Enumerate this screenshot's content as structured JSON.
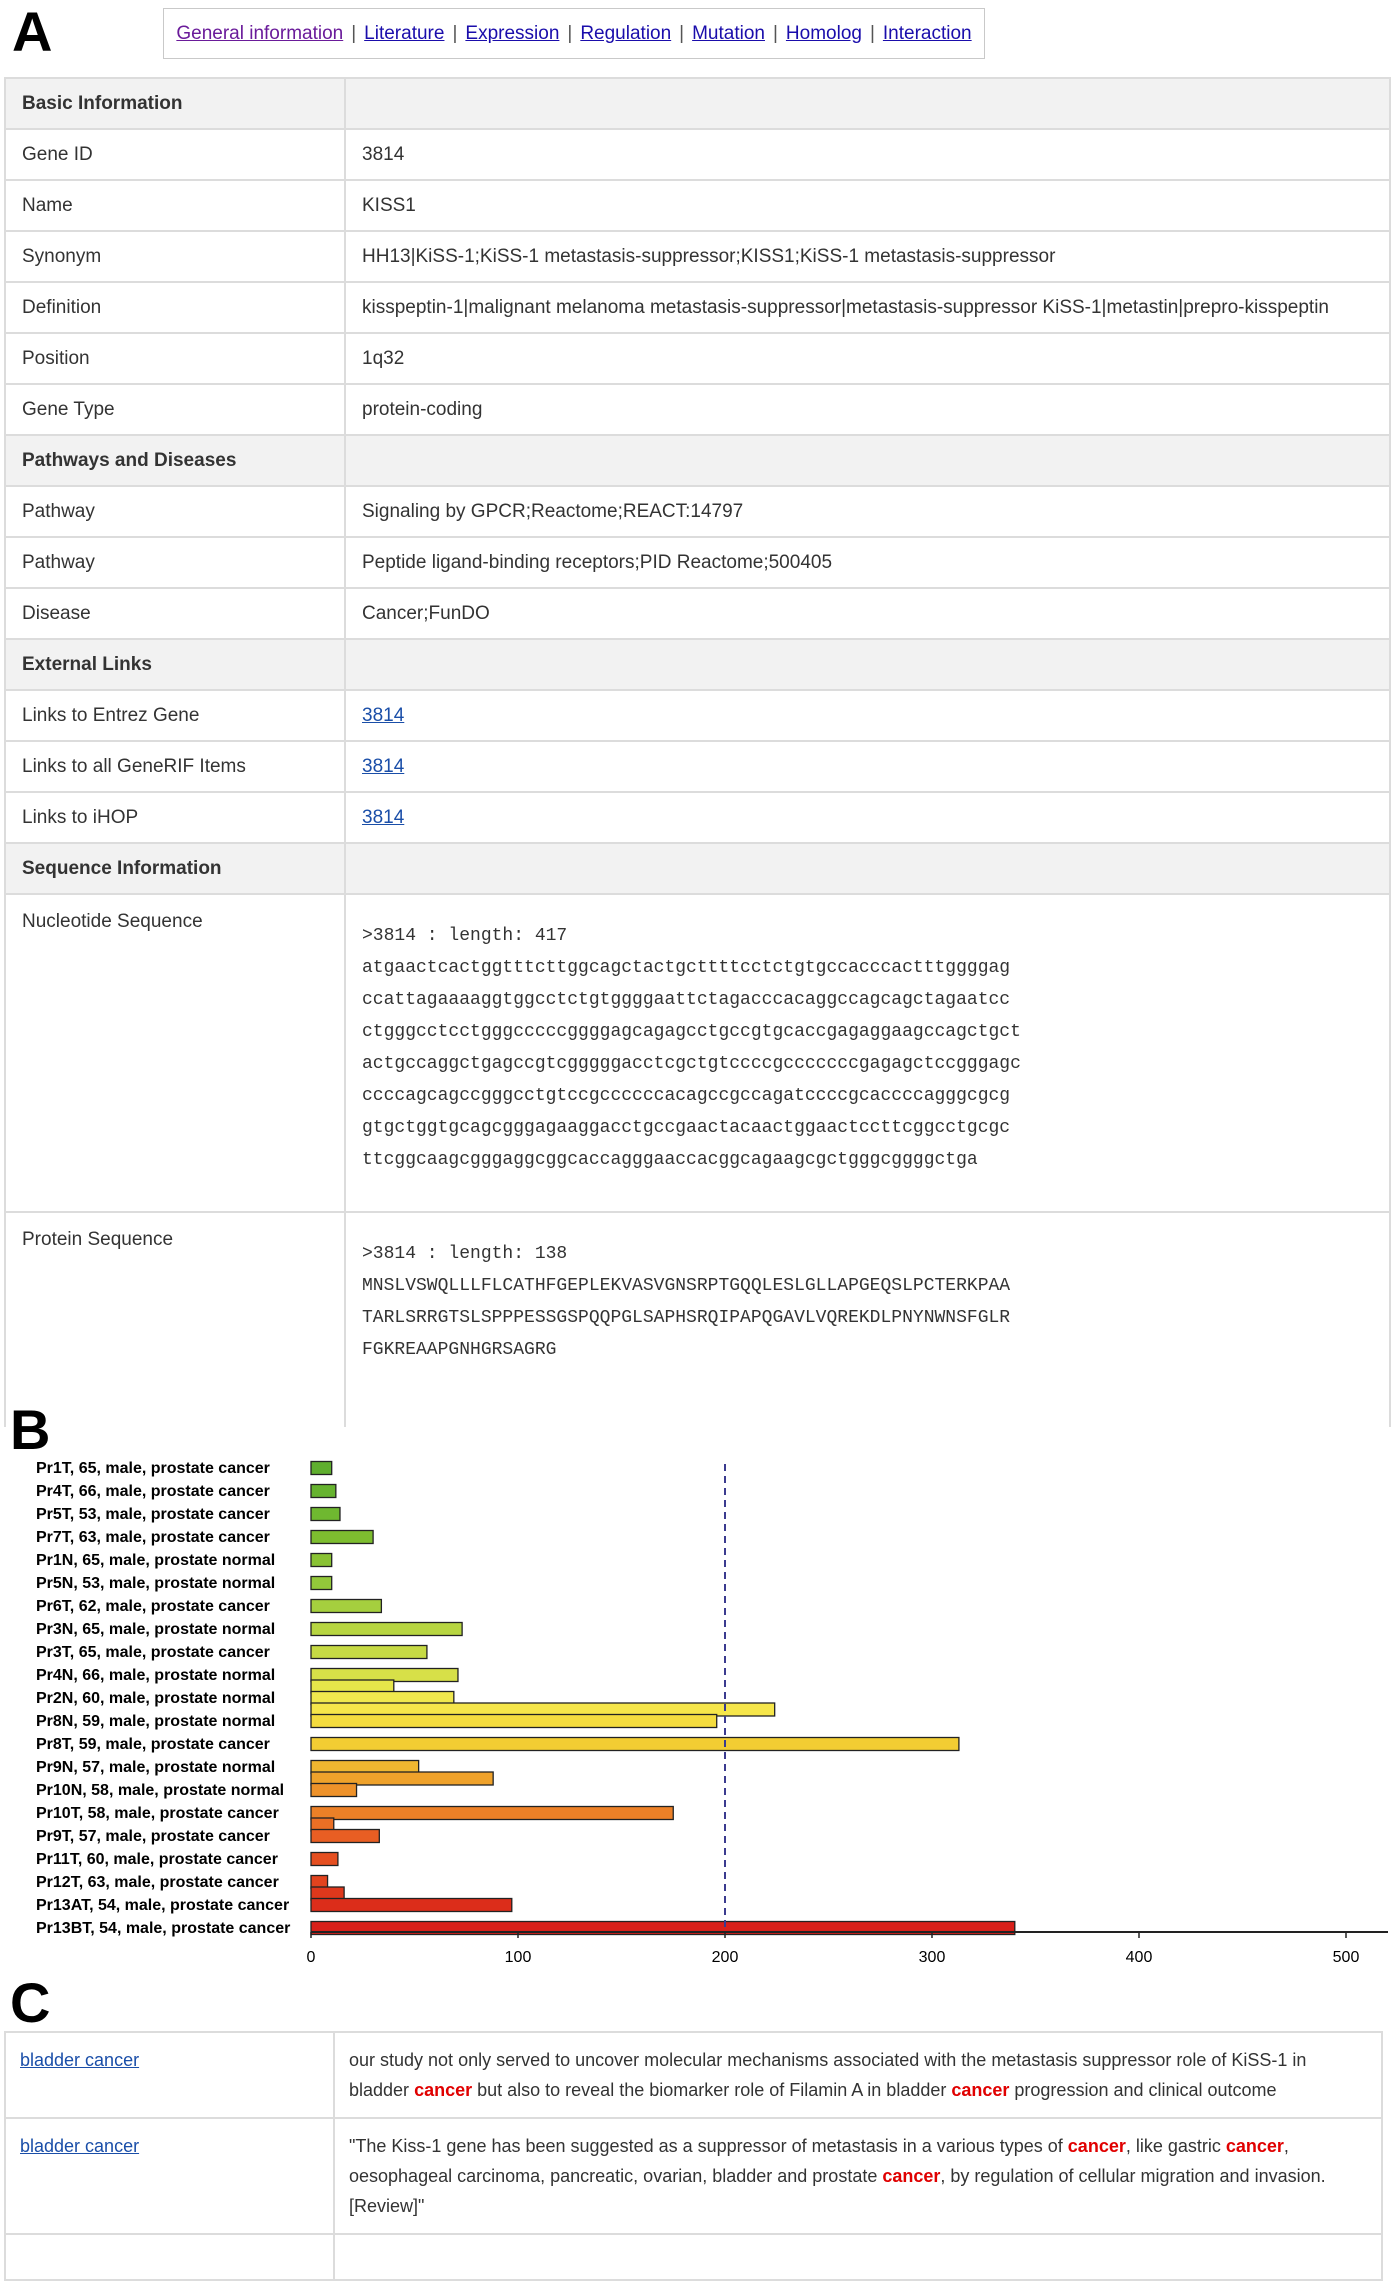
{
  "panels": {
    "a": "A",
    "b": "B",
    "c": "C"
  },
  "tabs": [
    {
      "label": "General information",
      "visited": true
    },
    {
      "label": "Literature"
    },
    {
      "label": "Expression"
    },
    {
      "label": "Regulation"
    },
    {
      "label": "Mutation"
    },
    {
      "label": "Homolog"
    },
    {
      "label": "Interaction"
    }
  ],
  "tab_separator": "|",
  "info": {
    "basic_header": "Basic Information",
    "gene_id": {
      "label": "Gene ID",
      "value": "3814"
    },
    "name": {
      "label": "Name",
      "value": "KISS1"
    },
    "synonym": {
      "label": "Synonym",
      "value": "HH13|KiSS-1;KiSS-1 metastasis-suppressor;KISS1;KiSS-1 metastasis-suppressor"
    },
    "definition": {
      "label": "Definition",
      "value": "kisspeptin-1|malignant melanoma metastasis-suppressor|metastasis-suppressor KiSS-1|metastin|prepro-kisspeptin"
    },
    "position": {
      "label": "Position",
      "value": "1q32"
    },
    "gene_type": {
      "label": "Gene Type",
      "value": "protein-coding"
    },
    "pathways_header": "Pathways and Diseases",
    "pathway1": {
      "label": "Pathway",
      "value": "Signaling by GPCR;Reactome;REACT:14797"
    },
    "pathway2": {
      "label": "Pathway",
      "value": "Peptide ligand-binding receptors;PID Reactome;500405"
    },
    "disease": {
      "label": "Disease",
      "value": "Cancer;FunDO"
    },
    "links_header": "External Links",
    "entrez": {
      "label": "Links to Entrez Gene",
      "value": "3814"
    },
    "generif": {
      "label": "Links to all GeneRIF Items",
      "value": "3814"
    },
    "ihop": {
      "label": "Links to iHOP",
      "value": "3814"
    },
    "sequence_header": "Sequence Information",
    "nucleotide": {
      "label": "Nucleotide Sequence",
      "lines": [
        ">3814 : length: 417",
        "atgaactcactggtttcttggcagctactgcttttcctctgtgccacccactttggggag",
        "ccattagaaaaggtggcctctgtggggaattctagacccacaggccagcagctagaatcc",
        "ctgggcctcctgggcccccggggagcagagcctgccgtgcaccgagaggaagccagctgct",
        "actgccaggctgagccgtcgggggacctcgctgtccccgcccccccgagagctccgggagc",
        "ccccagcagccgggcctgtccgccccccacagccgccagatccccgcaccccagggcgcg",
        "gtgctggtgcagcgggagaaggacctgccgaactacaactggaactccttcggcctgcgc",
        "ttcggcaagcgggaggcggcaccagggaaccacggcagaagcgctgggcggggctga"
      ]
    },
    "protein": {
      "label": "Protein Sequence",
      "lines": [
        ">3814 : length: 138",
        "MNSLVSWQLLLFLCATHFGEPLEKVASVGNSRPTGQQLESLGLLAPGEQSLPCTERKPAA",
        "TARLSRRGTSLSPPPESSGSPQQPGLSAPHSRQIPAPQGAVLVQREKDLPNYNWNSFGLR",
        "FGKREAAPGNHGRSAGRG"
      ]
    }
  },
  "chart_data": {
    "type": "bar",
    "orientation": "horizontal",
    "categories": [
      "Pr1T, 65, male, prostate cancer",
      "Pr4T, 66, male, prostate cancer",
      "Pr5T, 53, male, prostate cancer",
      "Pr7T, 63, male, prostate cancer",
      "Pr1N, 65, male, prostate normal",
      "Pr5N, 53, male, prostate normal",
      "Pr6T, 62, male, prostate cancer",
      "Pr3N, 65, male, prostate normal",
      "Pr3T, 65, male, prostate cancer",
      "Pr4N, 66, male, prostate normal",
      "Pr2N, 60, male, prostate normal",
      "Pr8N, 59, male, prostate normal",
      "Pr8T, 59, male, prostate cancer",
      "Pr9N, 57, male, prostate normal",
      "Pr10N, 58, male, prostate normal",
      "Pr10T, 58, male, prostate cancer",
      "Pr9T, 57, male, prostate cancer",
      "Pr11T, 60, male, prostate cancer",
      "Pr12T, 63, male, prostate cancer",
      "Pr13AT, 54, male, prostate cancer",
      "Pr13BT, 54, male, prostate cancer"
    ],
    "values": [
      10,
      12,
      14,
      30,
      10,
      10,
      34,
      73,
      56,
      71,
      40,
      69,
      224,
      196,
      313,
      52,
      88,
      22,
      175,
      11,
      33,
      13,
      8,
      16,
      97,
      340
    ],
    "bar_rows": [
      0,
      1,
      2,
      3,
      4,
      5,
      6,
      7,
      8,
      9,
      9.5,
      10,
      10.5,
      11,
      12,
      13,
      13.5,
      14,
      15,
      15.5,
      16,
      17,
      18,
      18.5,
      19,
      20
    ],
    "colors": [
      "#5fae2e",
      "#66b32f",
      "#6fb830",
      "#7dbd2f",
      "#89c234",
      "#93c83a",
      "#a5cf3e",
      "#b7d541",
      "#c6da44",
      "#d7e048",
      "#e6e64a",
      "#f0e84e",
      "#f6e64a",
      "#f4dc3e",
      "#f2cd33",
      "#f0b730",
      "#efa22b",
      "#ee922a",
      "#ec8027",
      "#ea6f25",
      "#e85e23",
      "#e54f20",
      "#e2431e",
      "#df381c",
      "#dc2d1a",
      "#d8201a"
    ],
    "xlim": [
      0,
      520
    ],
    "xticks": [
      0,
      100,
      200,
      300,
      400,
      500
    ],
    "reference_line": 200
  },
  "literature": [
    {
      "disease": "bladder cancer",
      "segments": [
        {
          "text": "our study not only served to uncover molecular mechanisms associated with the metastasis suppressor role of KiSS-1 in bladder "
        },
        {
          "text": "cancer",
          "hl": true
        },
        {
          "text": " but also to reveal the biomarker role of Filamin A in bladder "
        },
        {
          "text": "cancer",
          "hl": true
        },
        {
          "text": " progression and clinical outcome"
        }
      ]
    },
    {
      "disease": "bladder cancer",
      "segments": [
        {
          "text": "\"The Kiss-1 gene has been suggested as a suppressor of metastasis in a various types of "
        },
        {
          "text": "cancer",
          "hl": true
        },
        {
          "text": ", like gastric "
        },
        {
          "text": "cancer",
          "hl": true
        },
        {
          "text": ", oesophageal carcinoma, pancreatic, ovarian, bladder and prostate "
        },
        {
          "text": "cancer",
          "hl": true
        },
        {
          "text": ", by regulation of cellular migration and invasion. [Review]\""
        }
      ]
    }
  ]
}
